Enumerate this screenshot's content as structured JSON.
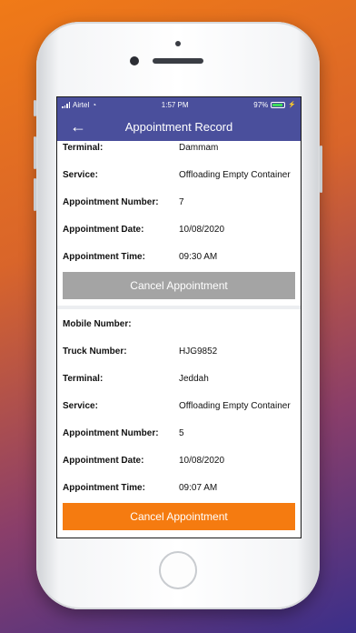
{
  "status": {
    "carrier": "Airtel",
    "time": "1:57 PM",
    "battery": "97%"
  },
  "header": {
    "title": "Appointment Record"
  },
  "record1": {
    "terminal_label": "Terminal:",
    "terminal": "Dammam",
    "service_label": "Service:",
    "service": "Offloading Empty Container",
    "number_label": "Appointment Number:",
    "number": "7",
    "date_label": "Appointment Date:",
    "date": "10/08/2020",
    "time_label": "Appointment Time:",
    "time": "09:30 AM",
    "cancel_label": "Cancel Appointment"
  },
  "record2": {
    "mobile_label": "Mobile Number:",
    "mobile": "",
    "truck_label": "Truck Number:",
    "truck": "HJG9852",
    "terminal_label": "Terminal:",
    "terminal": "Jeddah",
    "service_label": "Service:",
    "service": "Offloading Empty Container",
    "number_label": "Appointment Number:",
    "number": "5",
    "date_label": "Appointment Date:",
    "date": "10/08/2020",
    "time_label": "Appointment Time:",
    "time": "09:07 AM",
    "cancel_label": "Cancel Appointment"
  },
  "colors": {
    "nav": "#4a4f9c",
    "cancel_disabled": "#a4a4a4",
    "cancel_active": "#f57b10"
  }
}
